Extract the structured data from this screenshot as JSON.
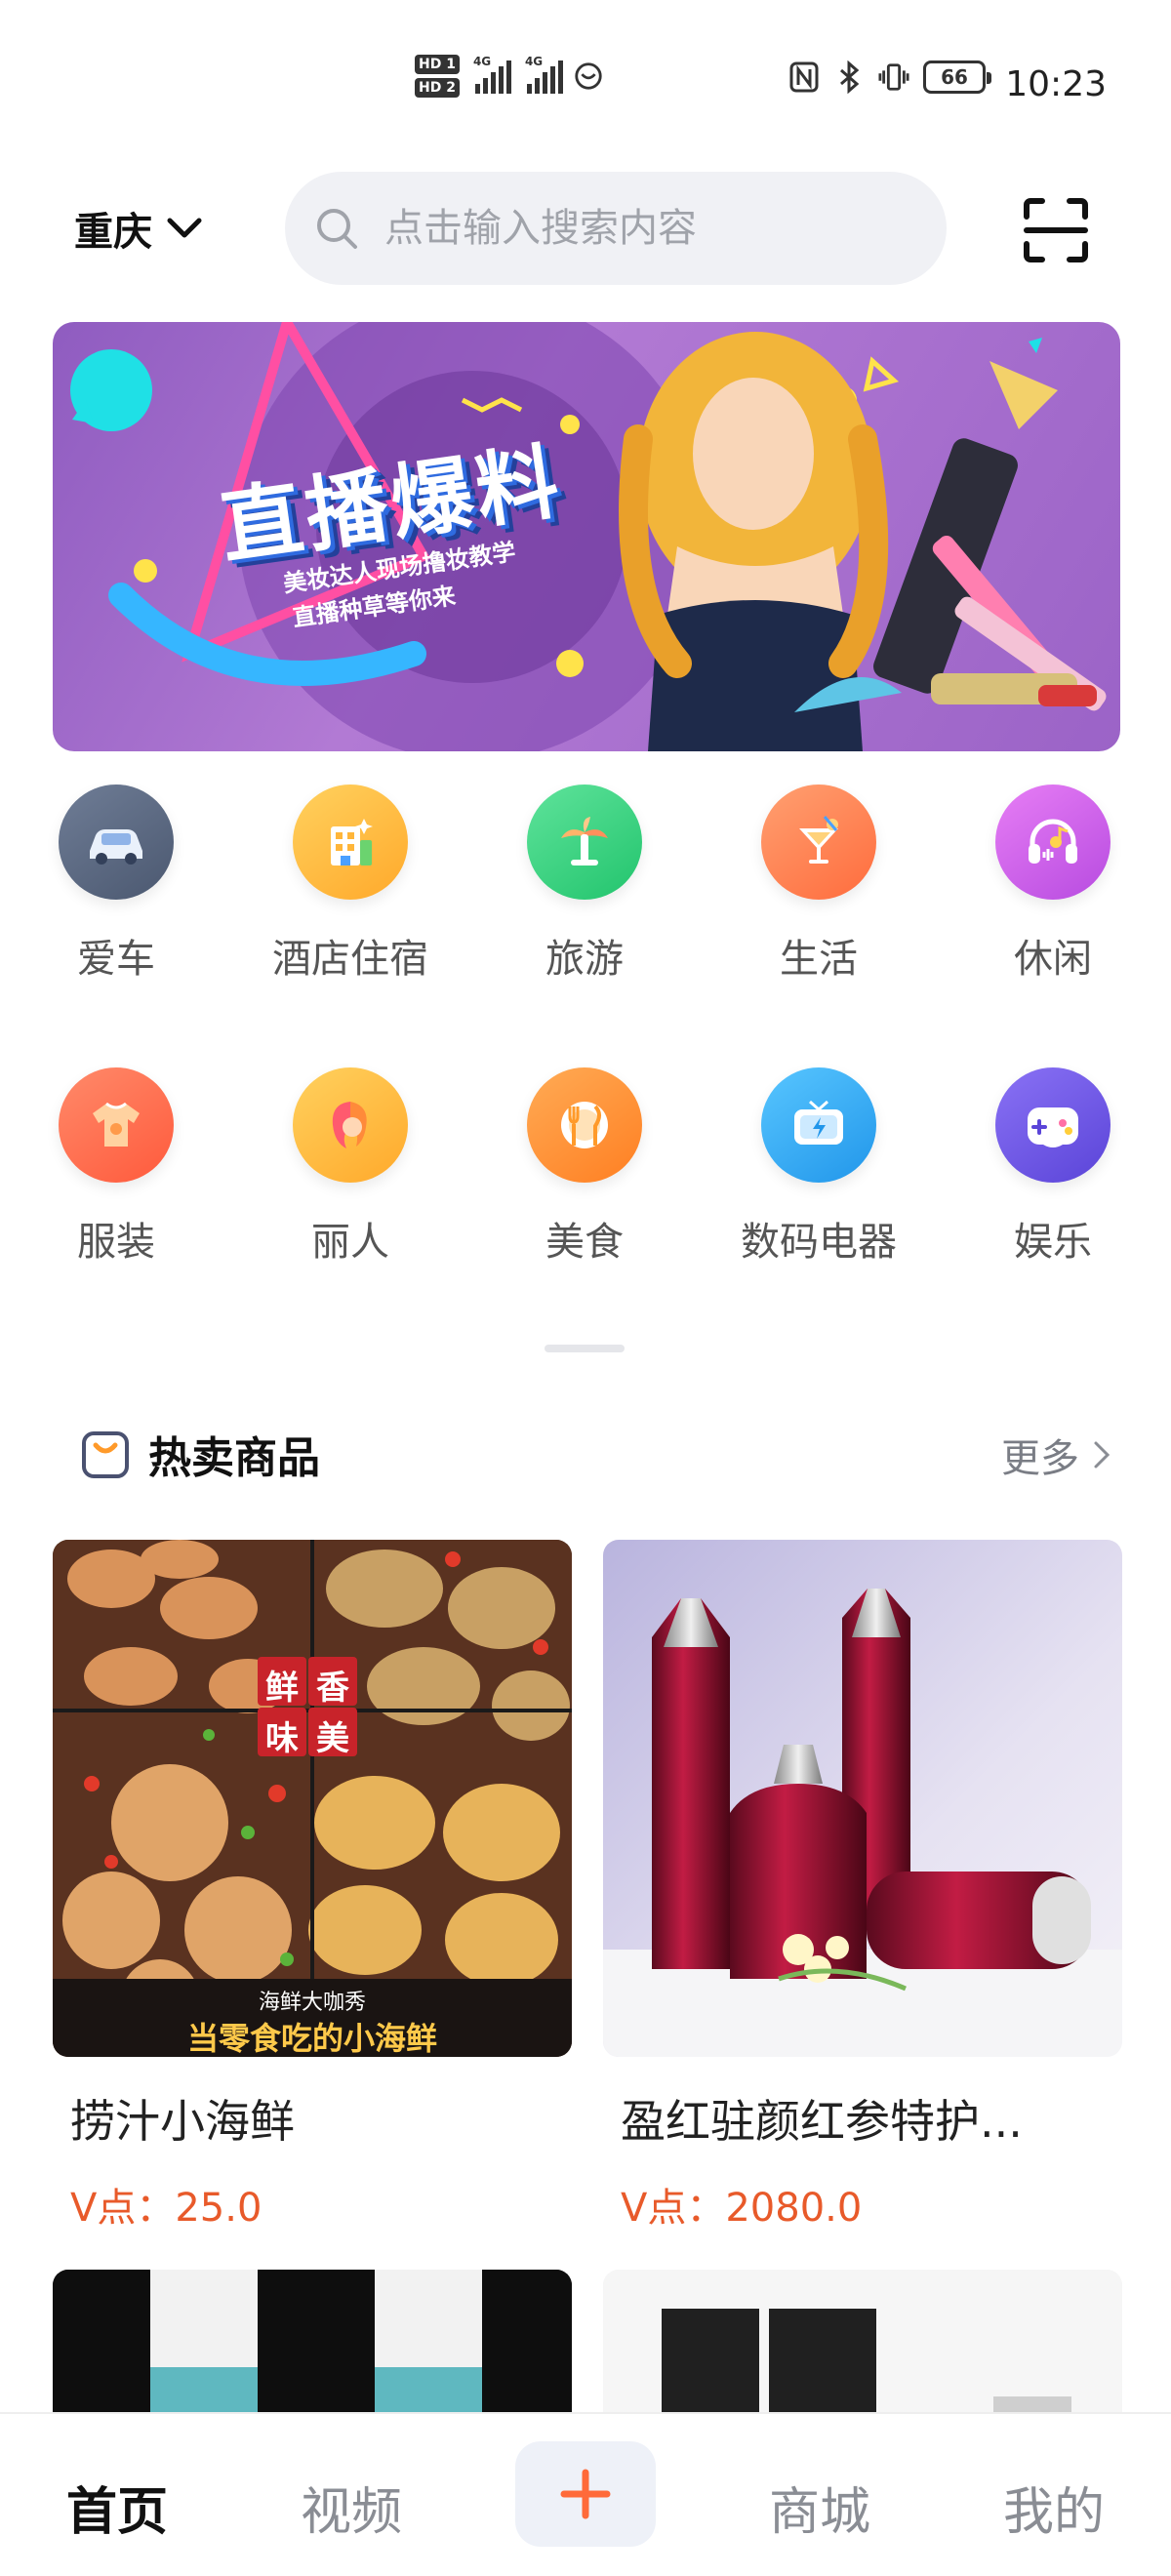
{
  "status_bar": {
    "time": "10:23",
    "battery": "66",
    "hd1": "HD 1",
    "hd2": "HD 2",
    "net1": "4G",
    "net2": "4G",
    "icons": [
      "nfc-icon",
      "bluetooth-icon",
      "vibrate-icon"
    ]
  },
  "header": {
    "city": "重庆",
    "search_placeholder": "点击输入搜索内容"
  },
  "banner": {
    "title": "直播爆料",
    "subtitle_1": "美妆达人现场撸妆教学",
    "subtitle_2": "直播种草等你来"
  },
  "categories": [
    {
      "label": "爱车",
      "icon": "car-icon",
      "color": "#5c6a82"
    },
    {
      "label": "酒店住宿",
      "icon": "hotel-icon",
      "color": "#ffb63a"
    },
    {
      "label": "旅游",
      "icon": "palm-tree-icon",
      "color": "#2fd27e"
    },
    {
      "label": "生活",
      "icon": "cocktail-icon",
      "color": "#ff7d45"
    },
    {
      "label": "休闲",
      "icon": "headphones-icon",
      "color": "#d05de8"
    },
    {
      "label": "服装",
      "icon": "tshirt-icon",
      "color": "#ff6a4a"
    },
    {
      "label": "丽人",
      "icon": "beauty-icon",
      "color": "#ffb32e"
    },
    {
      "label": "美食",
      "icon": "dining-icon",
      "color": "#ff8a2a"
    },
    {
      "label": "数码电器",
      "icon": "tv-icon",
      "color": "#2eaaf0"
    },
    {
      "label": "娱乐",
      "icon": "gamepad-icon",
      "color": "#7259e8"
    }
  ],
  "hot_section": {
    "title": "热卖商品",
    "more": "更多"
  },
  "products": [
    {
      "name": "捞汁小海鲜",
      "price": "V点：25.0",
      "tag_1": "鲜",
      "tag_2": "香",
      "tag_3": "味",
      "tag_4": "美",
      "caption_small": "海鲜大咖秀",
      "caption_big": "当零食吃的小海鲜"
    },
    {
      "name": "盈红驻颜红参特护...",
      "price": "V点：2080.0"
    }
  ],
  "bottom_nav": {
    "home": "首页",
    "video": "视频",
    "mall": "商城",
    "mine": "我的"
  }
}
